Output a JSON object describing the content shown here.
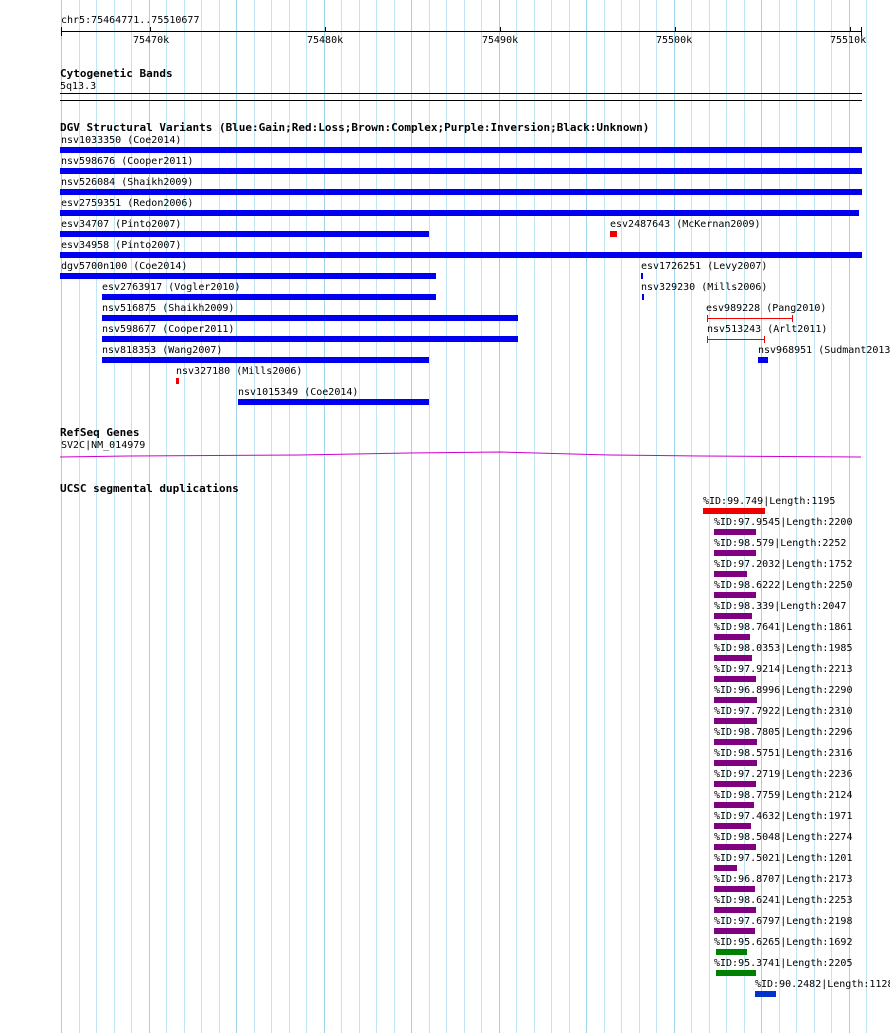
{
  "colors": {
    "gain": "#0000ee",
    "loss": "#ee0000",
    "segdup_red": "#ee0000",
    "segdup_purple": "#800080",
    "segdup_green": "#008000",
    "segdup_blue": "#0033cc",
    "gene": "#cc00cc",
    "grid": "#bfe6f2"
  },
  "ruler": {
    "location": "chr5:75464771..75510677",
    "ticks": [
      "75470k",
      "75480k",
      "75490k",
      "75500k",
      "75510k"
    ]
  },
  "cytoband": {
    "title": "Cytogenetic Bands",
    "band": "5q13.3"
  },
  "dgv": {
    "title": "DGV Structural Variants (Blue:Gain;Red:Loss;Brown:Complex;Purple:Inversion;Black:Unknown)",
    "variants": [
      {
        "label": "nsv1033350 (Coe2014)",
        "type": "gain"
      },
      {
        "label": "nsv598676 (Cooper2011)",
        "type": "gain"
      },
      {
        "label": "nsv526084 (Shaikh2009)",
        "type": "gain"
      },
      {
        "label": "esv2759351 (Redon2006)",
        "type": "gain"
      },
      {
        "label": "esv34707 (Pinto2007)",
        "type": "gain"
      },
      {
        "label": "esv2487643 (McKernan2009)",
        "type": "loss"
      },
      {
        "label": "esv34958 (Pinto2007)",
        "type": "gain"
      },
      {
        "label": "dgv5700n100 (Coe2014)",
        "type": "gain"
      },
      {
        "label": "esv1726251 (Levy2007)",
        "type": "gain"
      },
      {
        "label": "esv2763917 (Vogler2010)",
        "type": "gain"
      },
      {
        "label": "nsv329230 (Mills2006)",
        "type": "gain"
      },
      {
        "label": "nsv516875 (Shaikh2009)",
        "type": "gain"
      },
      {
        "label": "esv989228 (Pang2010)",
        "type": "loss"
      },
      {
        "label": "nsv598677 (Cooper2011)",
        "type": "gain"
      },
      {
        "label": "nsv513243 (Arlt2011)",
        "type": "loss"
      },
      {
        "label": "nsv818353 (Wang2007)",
        "type": "gain"
      },
      {
        "label": "nsv968951 (Sudmant2013",
        "type": "gain"
      },
      {
        "label": "nsv327180 (Mills2006)",
        "type": "loss"
      },
      {
        "label": "nsv1015349 (Coe2014)",
        "type": "gain"
      }
    ]
  },
  "refseq": {
    "title": "RefSeq Genes",
    "gene": "SV2C|NM_014979"
  },
  "segdups": {
    "title": "UCSC segmental duplications",
    "items": [
      {
        "label": "%ID:99.749|Length:1195",
        "color": "red"
      },
      {
        "label": "%ID:97.9545|Length:2200",
        "color": "purple"
      },
      {
        "label": "%ID:98.579|Length:2252",
        "color": "purple"
      },
      {
        "label": "%ID:97.2032|Length:1752",
        "color": "purple"
      },
      {
        "label": "%ID:98.6222|Length:2250",
        "color": "purple"
      },
      {
        "label": "%ID:98.339|Length:2047",
        "color": "purple"
      },
      {
        "label": "%ID:98.7641|Length:1861",
        "color": "purple"
      },
      {
        "label": "%ID:98.0353|Length:1985",
        "color": "purple"
      },
      {
        "label": "%ID:97.9214|Length:2213",
        "color": "purple"
      },
      {
        "label": "%ID:96.8996|Length:2290",
        "color": "purple"
      },
      {
        "label": "%ID:97.7922|Length:2310",
        "color": "purple"
      },
      {
        "label": "%ID:98.7805|Length:2296",
        "color": "purple"
      },
      {
        "label": "%ID:98.5751|Length:2316",
        "color": "purple"
      },
      {
        "label": "%ID:97.2719|Length:2236",
        "color": "purple"
      },
      {
        "label": "%ID:98.7759|Length:2124",
        "color": "purple"
      },
      {
        "label": "%ID:97.4632|Length:1971",
        "color": "purple"
      },
      {
        "label": "%ID:98.5048|Length:2274",
        "color": "purple"
      },
      {
        "label": "%ID:97.5021|Length:1201",
        "color": "purple"
      },
      {
        "label": "%ID:96.8707|Length:2173",
        "color": "purple"
      },
      {
        "label": "%ID:98.6241|Length:2253",
        "color": "purple"
      },
      {
        "label": "%ID:97.6797|Length:2198",
        "color": "purple"
      },
      {
        "label": "%ID:95.6265|Length:1692",
        "color": "green"
      },
      {
        "label": "%ID:95.3741|Length:2205",
        "color": "green"
      },
      {
        "label": "%ID:90.2482|Length:1128",
        "color": "blue"
      }
    ]
  }
}
